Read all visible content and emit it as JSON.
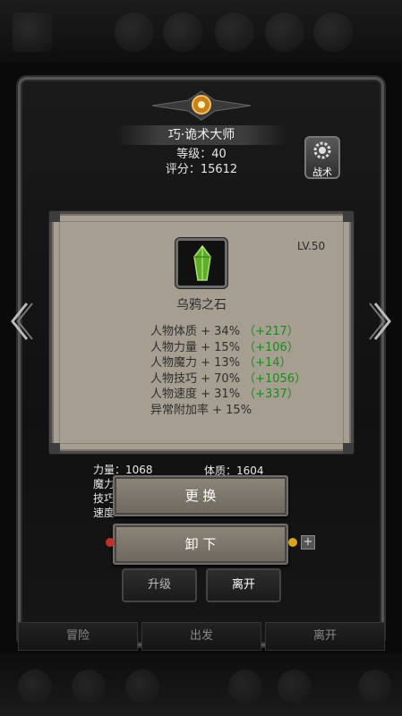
{
  "hero": {
    "title": "巧·诡术大师",
    "level": "等级：40",
    "score": "评分：15612"
  },
  "tactics": {
    "label": "战术"
  },
  "item": {
    "level": "LV.50",
    "name": "乌鸦之石",
    "icon": "green-crystal-icon",
    "attributes": [
      {
        "text": "人物体质 + 34%",
        "bonus": "（+217）"
      },
      {
        "text": "人物力量 + 15%",
        "bonus": "（+106）"
      },
      {
        "text": "人物魔力 + 13%",
        "bonus": "（+14）"
      },
      {
        "text": "人物技巧 + 70%",
        "bonus": "（+1056）"
      },
      {
        "text": "人物速度 + 31%",
        "bonus": "（+337）"
      },
      {
        "text": "异常附加率 + 15%",
        "bonus": ""
      }
    ]
  },
  "stats": {
    "strength": "力量：1068",
    "magic": "魔力",
    "skill": "技巧",
    "speed": "速度：1749",
    "constitution": "体质：1604"
  },
  "actions": {
    "swap": "更 换",
    "remove": "卸 下",
    "upgrade": "升级",
    "leave": "离开"
  },
  "bottom_tabs": [
    "冒险",
    "出发",
    "离开"
  ],
  "colors": {
    "bonus_green": "#1d8a1d",
    "panel": "#a59e91",
    "frame": "#555555"
  }
}
